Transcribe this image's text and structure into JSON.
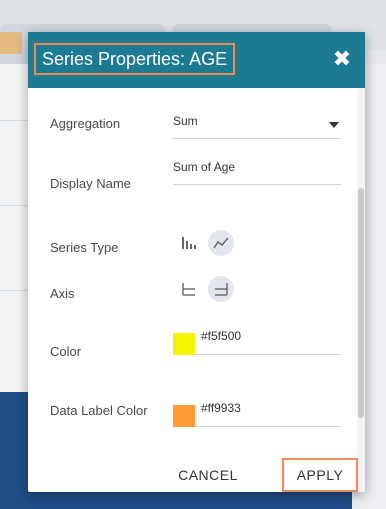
{
  "dialog": {
    "title": "Series Properties: AGE",
    "close_icon": "close-icon"
  },
  "aggregation": {
    "label": "Aggregation",
    "value": "Sum"
  },
  "display_name": {
    "label": "Display Name",
    "value": "Sum of Age"
  },
  "series_type": {
    "label": "Series Type",
    "icons": [
      "bar-chart-icon",
      "line-chart-icon"
    ],
    "selected": "line-chart-icon"
  },
  "axis": {
    "label": "Axis",
    "icons": [
      "axis-left-icon",
      "axis-right-icon"
    ],
    "selected": "axis-right-icon"
  },
  "color": {
    "label": "Color",
    "value": "#f5f500",
    "swatch": "#f5f500"
  },
  "data_label_color": {
    "label": "Data Label Color",
    "value": "#ff9933",
    "swatch": "#ff9933"
  },
  "buttons": {
    "cancel": "CANCEL",
    "apply": "APPLY"
  },
  "colors": {
    "header": "#1d7a93",
    "highlight": "#f08a54"
  }
}
